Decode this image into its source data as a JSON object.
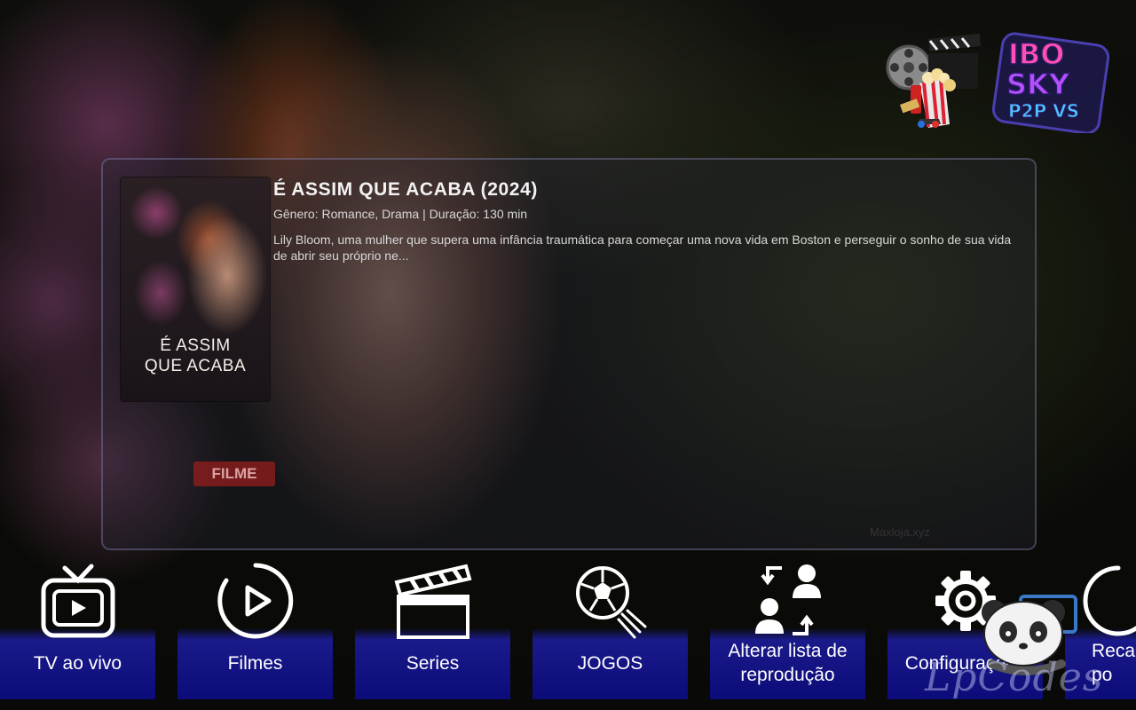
{
  "logos": {
    "film_icon": "film-reel-popcorn-icon",
    "brand_lines": [
      "IBO",
      "SKY",
      "P2P VS"
    ]
  },
  "featured": {
    "title": "É ASSIM QUE ACABA (2024)",
    "meta": "Gênero: Romance, Drama | Duração: 130 min",
    "description": "Lily Bloom, uma mulher que supera uma infância traumática para começar uma nova vida em Boston e perseguir o sonho de sua vida de abrir seu próprio ne...",
    "poster_title_line1": "É ASSIM",
    "poster_title_line2": "QUE ACABA",
    "type_badge": "FILME",
    "source_text": "Maxloja.xyz"
  },
  "nav": {
    "items": [
      {
        "label": "TV ao vivo",
        "icon": "tv-icon"
      },
      {
        "label": "Filmes",
        "icon": "play-circle-icon"
      },
      {
        "label": "Series",
        "icon": "clapperboard-icon"
      },
      {
        "label": "JOGOS",
        "icon": "soccer-ball-icon"
      },
      {
        "label_line1": "Alterar lista de",
        "label_line2": "reprodução",
        "icon": "switch-users-icon"
      },
      {
        "label": "Configurações",
        "icon": "gear-icon"
      },
      {
        "label_line1": "Reca",
        "label_line2": "po",
        "icon": "refresh-icon"
      }
    ]
  },
  "watermark": {
    "text": "LpCodes"
  },
  "colors": {
    "nav_tile": "#0b0b7a",
    "badge": "#961e1e"
  }
}
